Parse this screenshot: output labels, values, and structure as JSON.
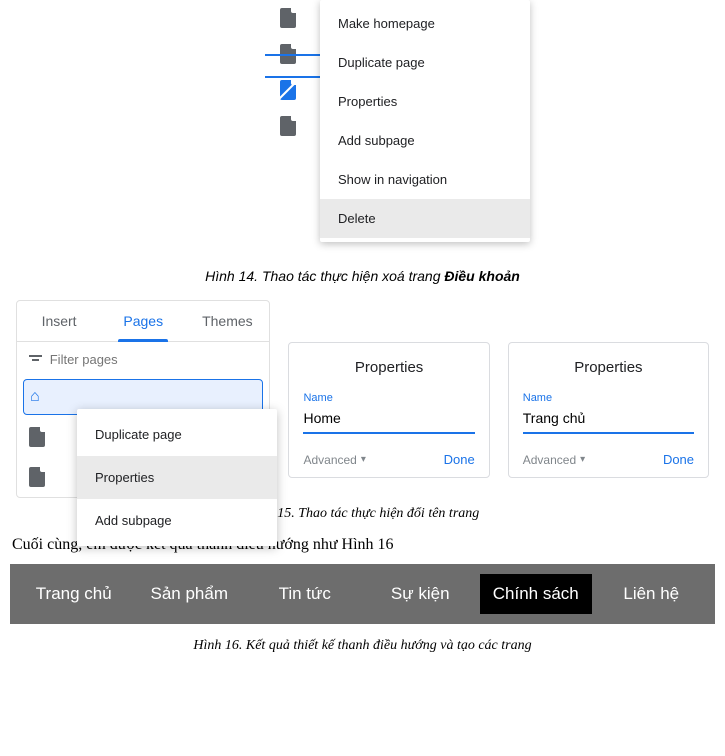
{
  "fig14": {
    "menu": [
      "Make homepage",
      "Duplicate page",
      "Properties",
      "Add subpage",
      "Show in navigation",
      "Delete"
    ],
    "highlighted_index": 5,
    "caption_prefix": "Hình 14. Thao tác thực hiện xoá trang ",
    "caption_strong": "Điều khoản"
  },
  "fig15": {
    "tabs": {
      "insert": "Insert",
      "pages": "Pages",
      "themes": "Themes"
    },
    "filter_placeholder": "Filter pages",
    "submenu": [
      "Duplicate page",
      "Properties",
      "Add subpage"
    ],
    "submenu_highlighted_index": 1,
    "props1": {
      "title": "Properties",
      "name_label": "Name",
      "name_value": "Home",
      "advanced": "Advanced",
      "done": "Done"
    },
    "props2": {
      "title": "Properties",
      "name_label": "Name",
      "name_value": "Trang chủ",
      "advanced": "Advanced",
      "done": "Done"
    },
    "caption": "Hình 15. Thao tác thực hiện đổi tên trang"
  },
  "body_text": "Cuối cùng, em được kết quả thanh điều hướng như Hình 16",
  "navbar": {
    "items": [
      "Trang chủ",
      "Sản phẩm",
      "Tin tức",
      "Sự kiện",
      "Chính sách",
      "Liên hệ"
    ],
    "active_index": 4
  },
  "fig16_caption": "Hình 16. Kết quả thiết kế thanh điều hướng và tạo các trang"
}
